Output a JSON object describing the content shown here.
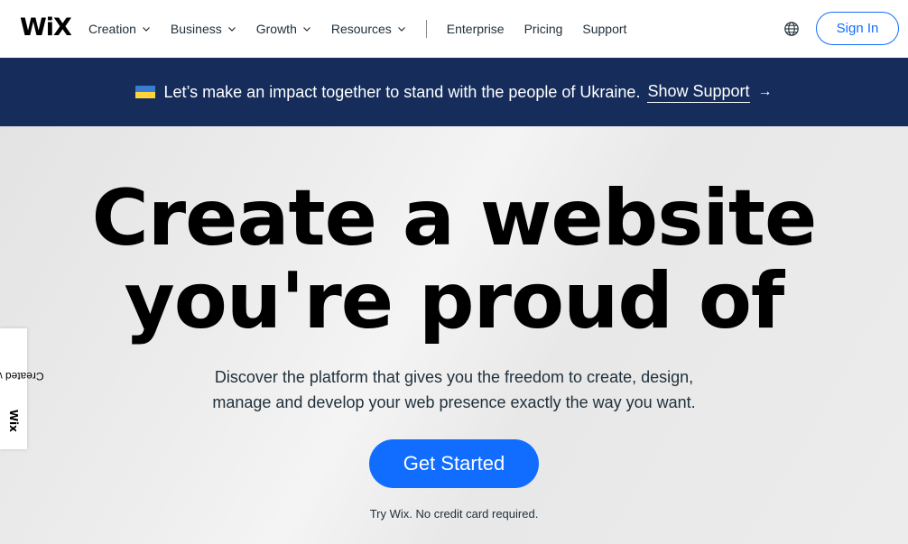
{
  "header": {
    "logo": "WiX",
    "nav": [
      {
        "label": "Creation",
        "has_dropdown": true
      },
      {
        "label": "Business",
        "has_dropdown": true
      },
      {
        "label": "Growth",
        "has_dropdown": true
      },
      {
        "label": "Resources",
        "has_dropdown": true
      }
    ],
    "nav_secondary": [
      {
        "label": "Enterprise"
      },
      {
        "label": "Pricing"
      },
      {
        "label": "Support"
      }
    ],
    "globe_icon": "globe-icon",
    "sign_in_label": "Sign In"
  },
  "banner": {
    "flag_icon": "ukraine-flag-icon",
    "text": "Let’s make an impact together to stand with the people of Ukraine.",
    "link_label": "Show Support",
    "arrow": "→"
  },
  "hero": {
    "title_line1": "Create a website",
    "title_line2": "you're proud of",
    "subtitle_line1": "Discover the platform that gives you the freedom to create, design,",
    "subtitle_line2": "manage and develop your web presence exactly the way you want.",
    "cta_label": "Get Started",
    "cta_note": "Try Wix. No credit card required."
  },
  "side_badge": {
    "prefix": "Created with",
    "brand": "Wix"
  },
  "colors": {
    "accent": "#116dff",
    "banner_bg": "#162d5c",
    "text_dark": "#20303c"
  }
}
